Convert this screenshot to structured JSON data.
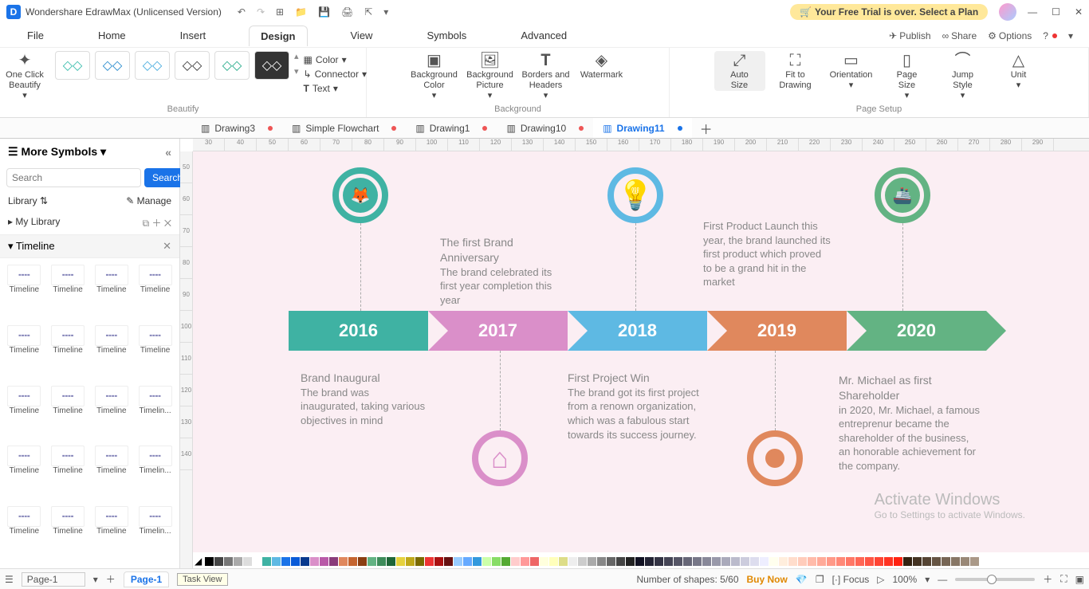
{
  "app": {
    "title": "Wondershare EdrawMax (Unlicensed Version)"
  },
  "trial": {
    "message": "Your Free Trial is over. Select a Plan"
  },
  "menu": {
    "file": "File",
    "home": "Home",
    "insert": "Insert",
    "design": "Design",
    "view": "View",
    "symbols": "Symbols",
    "advanced": "Advanced",
    "publish": "Publish",
    "share": "Share",
    "options": "Options"
  },
  "ribbon": {
    "beautify": "One Click\nBeautify",
    "beautify_group": "Beautify",
    "color": "Color",
    "connector": "Connector",
    "text": "Text",
    "bg_color": "Background\nColor",
    "bg_picture": "Background\nPicture",
    "borders": "Borders and\nHeaders",
    "watermark": "Watermark",
    "background_group": "Background",
    "auto_size": "Auto\nSize",
    "fit": "Fit to\nDrawing",
    "orientation": "Orientation",
    "page_size": "Page\nSize",
    "jump_style": "Jump\nStyle",
    "unit": "Unit",
    "pagesetup_group": "Page Setup"
  },
  "doc_tabs": {
    "t1": "Drawing3",
    "t2": "Simple Flowchart",
    "t3": "Drawing1",
    "t4": "Drawing10",
    "t5": "Drawing11"
  },
  "sidebar": {
    "more_symbols": "More Symbols",
    "search_placeholder": "Search",
    "search_btn": "Search",
    "library": "Library",
    "manage": "Manage",
    "my_library": "My Library",
    "section": "Timeline",
    "thumb_label": "Timeline",
    "thumb_label_trunc": "Timelin..."
  },
  "ruler_h": [
    "30",
    "40",
    "50",
    "60",
    "70",
    "80",
    "90",
    "100",
    "110",
    "120",
    "130",
    "140",
    "150",
    "160",
    "170",
    "180",
    "190",
    "200",
    "210",
    "220",
    "230",
    "240",
    "250",
    "260",
    "270",
    "280",
    "290"
  ],
  "ruler_v": [
    "50",
    "60",
    "70",
    "80",
    "90",
    "100",
    "110",
    "120",
    "130",
    "140"
  ],
  "timeline": {
    "y2016": {
      "year": "2016",
      "title": "Brand Inaugural",
      "body": "The brand was inaugurated, taking various objectives in mind"
    },
    "y2017": {
      "year": "2017",
      "title": "The first Brand Anniversary",
      "body": "The brand celebrated its first year completion this year"
    },
    "y2018": {
      "year": "2018",
      "title": "First Project Win",
      "body": "The brand got its first project from a renown organization, which was a fabulous start towards its success journey."
    },
    "y2019": {
      "year": "2019",
      "body": "First Product Launch this year, the brand launched its first product which proved to be a grand hit in the market"
    },
    "y2020": {
      "year": "2020",
      "title": "Mr. Michael as first Shareholder",
      "body": "in 2020, Mr. Michael, a famous entreprenur became the shareholder of the business, an honorable achievement for the company."
    }
  },
  "status": {
    "page_sel": "Page-1",
    "page_tab": "Page-1",
    "task_view": "Task View",
    "shapes": "Number of shapes: 5/60",
    "buy": "Buy Now",
    "focus": "Focus",
    "zoom": "100%"
  },
  "activate": {
    "line1": "Activate Windows",
    "line2": "Go to Settings to activate Windows."
  },
  "colors": [
    "#000",
    "#444",
    "#777",
    "#aaa",
    "#ddd",
    "#fff",
    "#3fb2a3",
    "#5eb9e3",
    "#1a73e8",
    "#0a5bd8",
    "#083a8e",
    "#da8fc9",
    "#b95aa8",
    "#8a3b7a",
    "#e0885d",
    "#c56530",
    "#8a3e12",
    "#63b383",
    "#3e8c5a",
    "#1f6638",
    "#e6d23e",
    "#bfa81a",
    "#7a6a00",
    "#e33",
    "#a11",
    "#611",
    "#9cf",
    "#6af",
    "#39d",
    "#cfa",
    "#8d6",
    "#5a3",
    "#fcc",
    "#f99",
    "#e66",
    "#ffd",
    "#ffb",
    "#dd8",
    "#eee",
    "#ccc",
    "#aaa",
    "#888",
    "#666",
    "#444",
    "#222",
    "#112",
    "#223",
    "#334",
    "#445",
    "#556",
    "#667",
    "#778",
    "#889",
    "#99a",
    "#aab",
    "#bbc",
    "#ccd",
    "#dde",
    "#eef",
    "#ffe",
    "#fed",
    "#fdc",
    "#fcb",
    "#fba",
    "#fa9",
    "#f98",
    "#f87",
    "#f76",
    "#f65",
    "#f54",
    "#f43",
    "#f32",
    "#f21",
    "#321",
    "#432",
    "#543",
    "#654",
    "#765",
    "#876",
    "#987",
    "#a98"
  ]
}
